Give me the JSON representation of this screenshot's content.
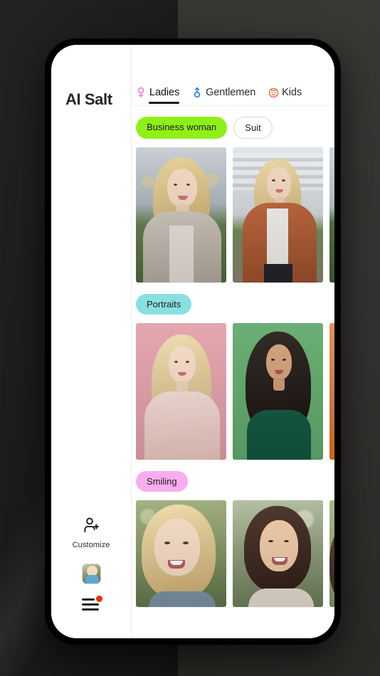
{
  "brand": {
    "name": "AI Salt"
  },
  "tabs": [
    {
      "id": "ladies",
      "label": "Ladies",
      "icon": "female-symbol-icon",
      "color": "#e86fd6",
      "active": true
    },
    {
      "id": "gentlemen",
      "label": "Gentlemen",
      "icon": "male-symbol-icon",
      "color": "#2f86e8",
      "active": false
    },
    {
      "id": "kids",
      "label": "Kids",
      "icon": "baby-face-icon",
      "color": "#f0643c",
      "active": false
    }
  ],
  "rail": {
    "customize": {
      "label": "Customize",
      "icon": "person-add-icon"
    },
    "avatar": {
      "icon": "avatar-thumbnail-icon"
    },
    "menu": {
      "icon": "hamburger-menu-icon",
      "badge": true,
      "badge_color": "#f02d0c"
    }
  },
  "sections": [
    {
      "id": "business",
      "chips": [
        {
          "label": "Business woman",
          "style": "filled",
          "color": "#8ff018"
        },
        {
          "label": "Suit",
          "style": "outline",
          "color": "#ffffff"
        }
      ],
      "cards": [
        {
          "id": "biz-1",
          "alt": "blonde-woman-grey-blazer"
        },
        {
          "id": "biz-2",
          "alt": "blonde-woman-brown-blazer"
        },
        {
          "id": "biz-3",
          "alt": "woman-partial-office"
        }
      ]
    },
    {
      "id": "portraits",
      "chips": [
        {
          "label": "Portraits",
          "style": "filled",
          "color": "#89e0e0"
        }
      ],
      "cards": [
        {
          "id": "por-1",
          "alt": "blonde-woman-pink-background"
        },
        {
          "id": "por-2",
          "alt": "dark-hair-woman-green-background"
        },
        {
          "id": "por-3",
          "alt": "woman-orange-background"
        }
      ]
    },
    {
      "id": "smiling",
      "chips": [
        {
          "label": "Smiling",
          "style": "filled",
          "color": "#f9acf0"
        }
      ],
      "cards": [
        {
          "id": "smi-1",
          "alt": "smiling-blonde-woman-outdoors"
        },
        {
          "id": "smi-2",
          "alt": "smiling-brunette-woman-outdoors"
        },
        {
          "id": "smi-3",
          "alt": "smiling-woman-partial"
        }
      ]
    }
  ]
}
